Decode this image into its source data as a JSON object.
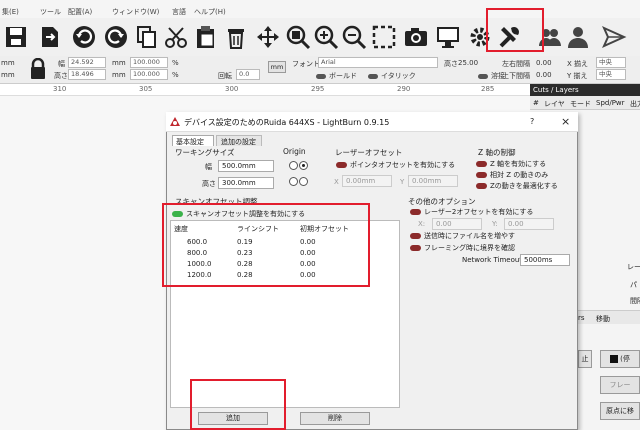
{
  "menu": [
    "集(E)",
    "ツール",
    "配置(A)",
    "ウィンドウ(W)",
    "言語",
    "ヘルプ(H)"
  ],
  "toolbar": {
    "icons": [
      "save-icon",
      "export-icon",
      "undo-icon",
      "redo-icon",
      "copy-icon",
      "cut-icon",
      "paste-icon",
      "delete-icon",
      "move-icon",
      "zoom-selection-icon",
      "zoom-in-icon",
      "zoom-out-icon",
      "frame-icon",
      "camera-icon",
      "monitor-icon",
      "settings-icon",
      "device-settings-icon",
      "users-icon",
      "user-icon",
      "send-icon"
    ]
  },
  "props": {
    "x_label": "mm",
    "y_label": "mm",
    "width_value": "24.592",
    "height_label": "高さ",
    "height_value": "18.496",
    "w_unit": "mm",
    "h_unit": "mm",
    "scale_w": "100.000",
    "scale_h": "100.000",
    "pct1": "%",
    "pct2": "%",
    "rotate_label": "回転",
    "rotate_value": "0.0",
    "mm_button": "mm",
    "font_label": "フォント",
    "font_value": "Arial",
    "font_height_label": "高さ",
    "font_height_value": "25.00",
    "bold_label": "ボールド",
    "italic_label": "イタリック",
    "hspace_label": "左右間隔",
    "hspace_value": "0.00",
    "vspace_label": "上下間隔",
    "vspace_value": "0.00",
    "weld_label": "溶接",
    "halign_label": "X 揃え",
    "halign_value": "中央",
    "valign_label": "Y 揃え",
    "valign_value": "中央"
  },
  "ruler": [
    "310",
    "305",
    "300",
    "295",
    "290",
    "285"
  ],
  "right_panel": {
    "title": "Cuts / Layers",
    "columns": [
      "#",
      "レイヤ",
      "モード",
      "Spd/Pwr",
      "出力"
    ],
    "side_labels": [
      "レー",
      "パ",
      "間隔"
    ],
    "tab_move": "移動",
    "tab_s": "rs",
    "btn_stop": "(停",
    "btn_frame": "フレー",
    "btn_origin": "原点に移",
    "btn_stop_small": "止"
  },
  "dialog": {
    "title": "デバイス設定のためのRuida 644XS - LightBurn 0.9.15",
    "help": "?",
    "close": "×",
    "tabs": [
      "基本設定",
      "追加の設定"
    ],
    "working_size": {
      "title": "ワーキングサイズ",
      "width_label": "幅",
      "width_value": "500.0mm",
      "height_label": "高さ",
      "height_value": "300.0mm"
    },
    "origin_title": "Origin",
    "laser_offset": {
      "title": "レーザーオフセット",
      "enable_label": "ポインタオフセットを有効にする",
      "x_label": "X",
      "x_value": "0.00mm",
      "y_label": "Y",
      "y_value": "0.00mm"
    },
    "z_axis": {
      "title": "Z 軸の制御",
      "items": [
        "Z 軸を有効にする",
        "相対 Z の動きのみ",
        "Zの動きを最適化する"
      ]
    },
    "scan_offset": {
      "title": "スキャンオフセット調整",
      "enable_label": "スキャンオフセット調整を有効にする",
      "headers": [
        "速度",
        "ラインシフト",
        "初期オフセット"
      ],
      "rows": [
        [
          "600.0",
          "0.19",
          "0.00"
        ],
        [
          "800.0",
          "0.23",
          "0.00"
        ],
        [
          "1000.0",
          "0.28",
          "0.00"
        ],
        [
          "1200.0",
          "0.28",
          "0.00"
        ]
      ],
      "add_button": "追加",
      "delete_button": "削除"
    },
    "other_options": {
      "title": "その他のオプション",
      "enable_2nd_offset": "レーザー2オフセットを有効にする",
      "x_label": "X:",
      "x_value": "0.00",
      "y_label": "Y:",
      "y_value": "0.00",
      "send_filename": "送信時にファイル名を増やす",
      "frame_border": "フレーミング時に境界を確認",
      "network_timeout_label": "Network Timeout",
      "network_timeout_value": "5000ms"
    }
  },
  "colors": {
    "highlight": "#e21d2d",
    "toggle_on": "#3bb24a",
    "toggle_off": "#8b2a2a",
    "title_bar_dark": "#2b2b2b"
  }
}
